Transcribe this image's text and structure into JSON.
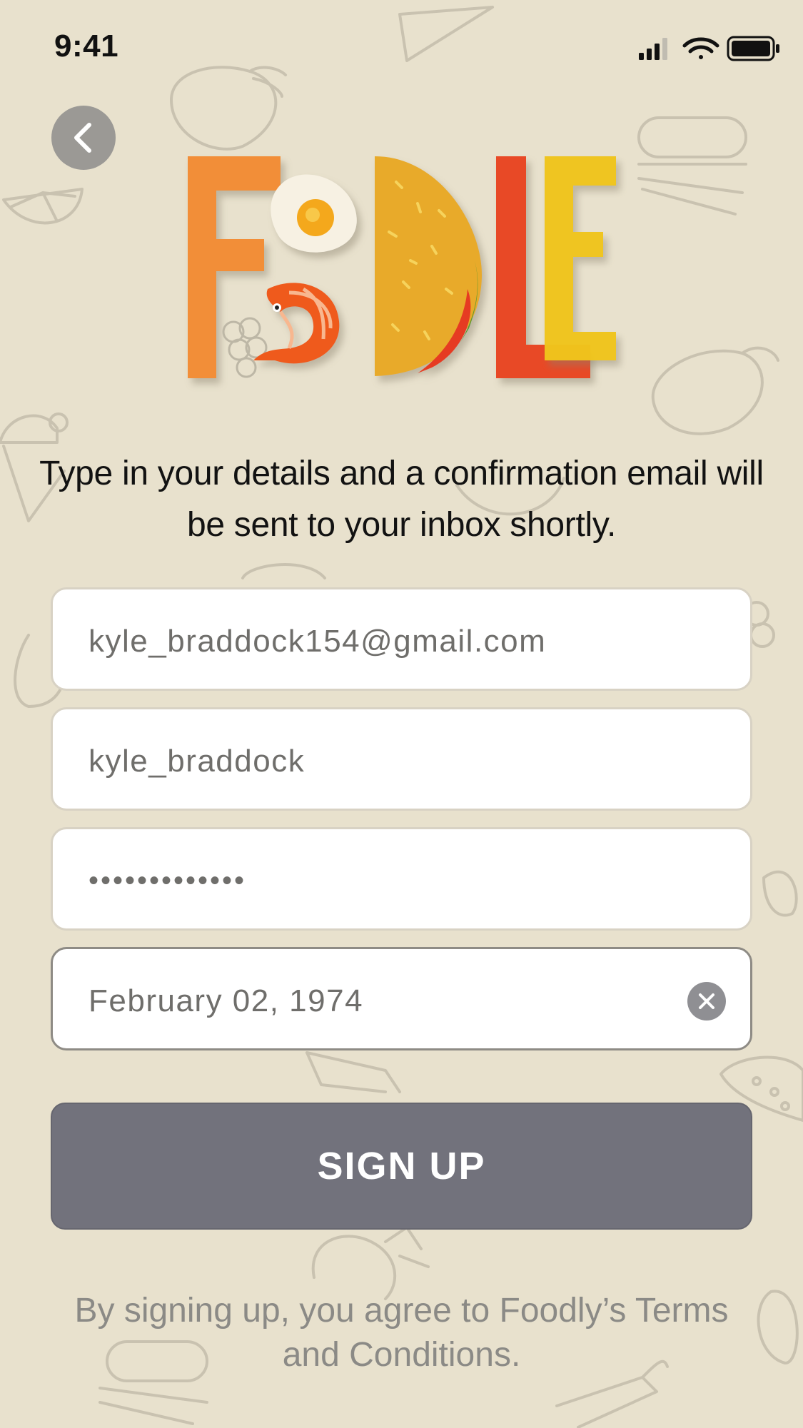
{
  "status_bar": {
    "time": "9:41"
  },
  "logo": {
    "text": "FOODLE",
    "letter_colors": [
      "#f28e38",
      "#f4c12c",
      "#e8aa2a",
      "#e84a25",
      "#f0c51e"
    ]
  },
  "intro_text": "Type in your details and a confirmation email will be sent to your inbox shortly.",
  "form": {
    "email_value": "kyle_braddock154@gmail.com",
    "username_value": "kyle_braddock",
    "password_value": "•••••••••••••",
    "birthdate_value": "February 02, 1974"
  },
  "signup_label": "SIGN UP",
  "terms_text": "By signing up, you agree to Foodly’s Terms and Conditions.",
  "colors": {
    "background": "#e8e1cd",
    "button": "#72727c",
    "back_button": "#9b9995"
  },
  "icons": {
    "back": "chevron-left-icon",
    "clear": "clear-icon",
    "signal": "signal-icon",
    "wifi": "wifi-icon",
    "battery": "battery-icon"
  }
}
